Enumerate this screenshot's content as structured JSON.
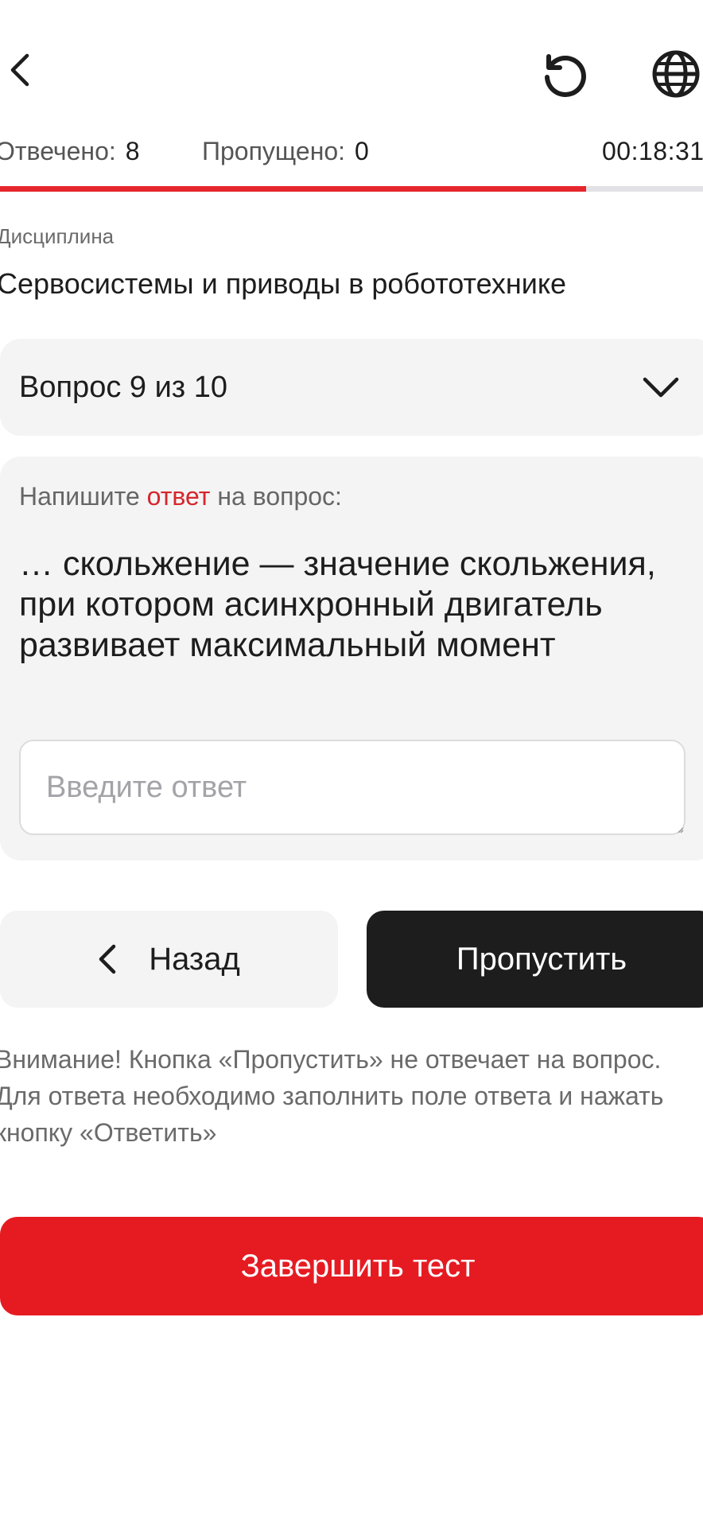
{
  "header": {
    "back_icon": "chevron-left-icon",
    "reset_icon": "reset-icon",
    "language_icon": "globe-icon"
  },
  "stats": {
    "answered_label": "Отвечено:",
    "answered_value": "8",
    "skipped_label": "Пропущено:",
    "skipped_value": "0",
    "timer": "00:18:31"
  },
  "progress": {
    "fraction": 0.834,
    "fill_color": "#e5262d",
    "track_color": "#e2e2e6"
  },
  "discipline": {
    "label": "Дисциплина",
    "name": "Сервосистемы и приводы в робототехнике"
  },
  "question_selector": {
    "label": "Вопрос 9 из 10",
    "icon": "chevron-down-icon"
  },
  "question": {
    "prompt_prefix": "Напишите ",
    "prompt_accent": "ответ",
    "prompt_suffix": " на вопрос:",
    "text": "… скольжение — значение скольжения, при котором асинхронный двигатель развивает максимальный момент",
    "answer_placeholder": "Введите ответ",
    "answer_value": ""
  },
  "actions": {
    "back_label": "Назад",
    "skip_label": "Пропустить",
    "finish_label": "Завершить тест"
  },
  "warning": {
    "text": "Внимание! Кнопка «Пропустить» не отвечает на вопрос. Для ответа необходимо заполнить поле ответа и нажать кнопку «Ответить»"
  },
  "colors": {
    "accent_red": "#e61b22",
    "dark": "#1d1d1d",
    "panel": "#f4f4f4"
  }
}
